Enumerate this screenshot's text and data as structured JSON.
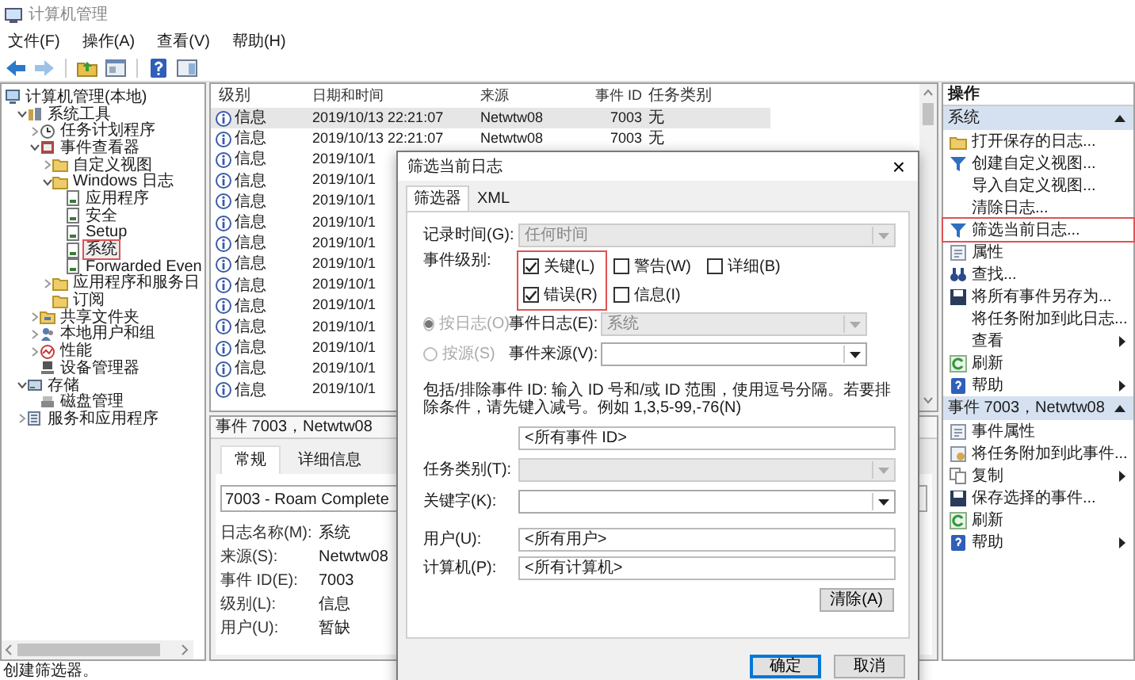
{
  "window": {
    "title": "计算机管理"
  },
  "menu": [
    "文件(F)",
    "操作(A)",
    "查看(V)",
    "帮助(H)"
  ],
  "toolbar": [
    {
      "kind": "back",
      "disabled": false
    },
    {
      "kind": "forward",
      "disabled": true
    },
    {
      "kind": "up",
      "disabled": false
    },
    {
      "kind": "console",
      "disabled": false
    },
    {
      "kind": "help",
      "disabled": false
    },
    {
      "kind": "panel",
      "disabled": false
    }
  ],
  "tree": [
    {
      "label": "计算机管理(本地)",
      "kind": "computer",
      "children": [
        {
          "label": "系统工具",
          "kind": "tools",
          "expanded": true,
          "children": [
            {
              "label": "任务计划程序",
              "kind": "clock",
              "expanded": false
            },
            {
              "label": "事件查看器",
              "kind": "viewer",
              "expanded": true,
              "children": [
                {
                  "label": "自定义视图",
                  "kind": "folder",
                  "expanded": false
                },
                {
                  "label": "Windows 日志",
                  "kind": "folder",
                  "expanded": true,
                  "children": [
                    {
                      "label": "应用程序",
                      "kind": "log",
                      "selected": false,
                      "highlighted": false
                    },
                    {
                      "label": "安全",
                      "kind": "log",
                      "selected": false,
                      "highlighted": false
                    },
                    {
                      "label": "Setup",
                      "kind": "log",
                      "selected": false,
                      "highlighted": false
                    },
                    {
                      "label": "系统",
                      "kind": "log",
                      "selected": true,
                      "highlighted": true
                    },
                    {
                      "label": "Forwarded Even",
                      "kind": "log",
                      "selected": false,
                      "highlighted": false
                    }
                  ]
                },
                {
                  "label": "应用程序和服务日",
                  "kind": "folder",
                  "expanded": false
                },
                {
                  "label": "订阅",
                  "kind": "folder"
                }
              ]
            },
            {
              "label": "共享文件夹",
              "kind": "share",
              "expanded": false
            },
            {
              "label": "本地用户和组",
              "kind": "users",
              "expanded": false
            },
            {
              "label": "性能",
              "kind": "performance",
              "expanded": false
            },
            {
              "label": "设备管理器",
              "kind": "device"
            }
          ]
        },
        {
          "label": "存储",
          "kind": "storage",
          "expanded": true,
          "children": [
            {
              "label": "磁盘管理",
              "kind": "disk"
            }
          ]
        },
        {
          "label": "服务和应用程序",
          "kind": "services",
          "expanded": false
        }
      ]
    }
  ],
  "events": {
    "columns": [
      "级别",
      "日期和时间",
      "来源",
      "事件 ID",
      "任务类别"
    ],
    "rows": [
      {
        "level": "信息",
        "date": "2019/10/13 22:21:07",
        "source": "Netwtw08",
        "id": "7003",
        "task": "无",
        "selected": true
      },
      {
        "level": "信息",
        "date": "2019/10/13 22:21:07",
        "source": "Netwtw08",
        "id": "7003",
        "task": "无",
        "selected": false
      },
      {
        "level": "信息",
        "date": "2019/10/1",
        "selected": false
      },
      {
        "level": "信息",
        "date": "2019/10/1",
        "selected": false
      },
      {
        "level": "信息",
        "date": "2019/10/1",
        "selected": false
      },
      {
        "level": "信息",
        "date": "2019/10/1",
        "selected": false
      },
      {
        "level": "信息",
        "date": "2019/10/1",
        "selected": false
      },
      {
        "level": "信息",
        "date": "2019/10/1",
        "selected": false
      },
      {
        "level": "信息",
        "date": "2019/10/1",
        "selected": false
      },
      {
        "level": "信息",
        "date": "2019/10/1",
        "selected": false
      },
      {
        "level": "信息",
        "date": "2019/10/1",
        "selected": false
      },
      {
        "level": "信息",
        "date": "2019/10/1",
        "selected": false
      },
      {
        "level": "信息",
        "date": "2019/10/1",
        "selected": false
      },
      {
        "level": "信息",
        "date": "2019/10/1",
        "selected": false
      }
    ]
  },
  "detail": {
    "title": "事件 7003，Netwtw08",
    "tabs": [
      {
        "label": "常规",
        "selected": true
      },
      {
        "label": "详细信息",
        "selected": false
      }
    ],
    "description": "7003 - Roam Complete",
    "fields": [
      {
        "label": "日志名称(M):",
        "value": "系统"
      },
      {
        "label": "来源(S):",
        "value": "Netwtw08"
      },
      {
        "label": "事件 ID(E):",
        "value": "7003"
      },
      {
        "label": "级别(L):",
        "value": "信息"
      },
      {
        "label": "用户(U):",
        "value": "暂缺"
      }
    ]
  },
  "actions": {
    "title": "操作",
    "sections": [
      {
        "title": "系统",
        "expanded": true,
        "items": [
          {
            "label": "打开保存的日志...",
            "kind": "open",
            "highlighted": false
          },
          {
            "label": "创建自定义视图...",
            "kind": "filter",
            "highlighted": false
          },
          {
            "label": "导入自定义视图...",
            "kind": "plain",
            "highlighted": false
          },
          {
            "label": "清除日志...",
            "kind": "plain",
            "highlighted": false
          },
          {
            "label": "筛选当前日志...",
            "kind": "filter",
            "highlighted": true
          },
          {
            "label": "属性",
            "kind": "properties",
            "highlighted": false
          },
          {
            "label": "查找...",
            "kind": "find",
            "highlighted": false
          },
          {
            "label": "将所有事件另存为...",
            "kind": "save",
            "highlighted": false
          },
          {
            "label": "将任务附加到此日志...",
            "kind": "plain",
            "highlighted": false
          },
          {
            "label": "查看",
            "kind": "plain",
            "submenu": true,
            "highlighted": false
          },
          {
            "label": "刷新",
            "kind": "refresh",
            "highlighted": false
          },
          {
            "label": "帮助",
            "kind": "help",
            "submenu": true,
            "highlighted": false
          }
        ]
      },
      {
        "title": "事件 7003，Netwtw08",
        "expanded": true,
        "items": [
          {
            "label": "事件属性",
            "kind": "properties",
            "highlighted": false
          },
          {
            "label": "将任务附加到此事件...",
            "kind": "attach",
            "highlighted": false
          },
          {
            "label": "复制",
            "kind": "copy",
            "submenu": true,
            "highlighted": false
          },
          {
            "label": "保存选择的事件...",
            "kind": "save",
            "highlighted": false
          },
          {
            "label": "刷新",
            "kind": "refresh",
            "highlighted": false
          },
          {
            "label": "帮助",
            "kind": "help",
            "submenu": true,
            "highlighted": false
          }
        ]
      }
    ]
  },
  "dialog": {
    "title": "筛选当前日志",
    "close": "×",
    "tabs": [
      {
        "label": "筛选器",
        "selected": true
      },
      {
        "label": "XML",
        "selected": false
      }
    ],
    "record_time": {
      "label": "记录时间(G):",
      "value": "任何时间",
      "disabled": true
    },
    "event_level": {
      "label": "事件级别:",
      "columns": [
        {
          "highlighted": true,
          "items": [
            {
              "label": "关键(L)",
              "checked": true
            },
            {
              "label": "错误(R)",
              "checked": true
            }
          ]
        },
        {
          "items": [
            {
              "label": "警告(W)",
              "checked": false
            },
            {
              "label": "信息(I)",
              "checked": false
            }
          ]
        },
        {
          "items": [
            {
              "label": "详细(B)",
              "checked": false
            }
          ]
        }
      ]
    },
    "sources": [
      {
        "label": "按日志(O)",
        "selected": true,
        "disabled": true,
        "field_label": "事件日志(E):",
        "value": "系统",
        "field_disabled": true
      },
      {
        "label": "按源(S)",
        "selected": false,
        "disabled": true,
        "field_label": "事件来源(V):",
        "field_disabled": false
      }
    ],
    "id_filter": {
      "description": "包括/排除事件 ID: 输入 ID 号和/或 ID 范围，使用逗号分隔。若要排除条件，请先键入减号。例如 1,3,5-99,-76(N)",
      "value": "<所有事件 ID>"
    },
    "task_category": {
      "label": "任务类别(T):",
      "disabled": true
    },
    "keyword": {
      "label": "关键字(K):",
      "disabled": false
    },
    "user": {
      "label": "用户(U):",
      "value": "<所有用户>"
    },
    "computer": {
      "label": "计算机(P):",
      "value": "<所有计算机>"
    },
    "clear_button": "清除(A)",
    "buttons": [
      {
        "label": "确定",
        "default": true
      },
      {
        "label": "取消",
        "default": false
      }
    ]
  },
  "status_bar": "创建筛选器。"
}
